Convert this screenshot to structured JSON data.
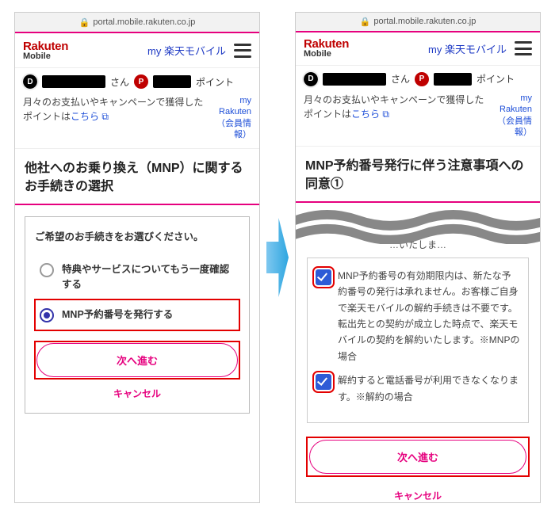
{
  "url": "portal.mobile.rakuten.co.jp",
  "brand": {
    "top": "Rakuten",
    "bottom": "Mobile"
  },
  "header": {
    "my_title": "my 楽天モバイル"
  },
  "userbar": {
    "san": "さん",
    "points_suffix": "ポイント"
  },
  "infoline": {
    "text_pre": "月々のお支払いやキャンペーンで獲得したポイントは",
    "link": "こちら",
    "myrakuten": "my Rakuten（会員情報）"
  },
  "left": {
    "title": "他社へのお乗り換え（MNP）に関するお手続きの選択",
    "card_lead": "ご希望のお手続きをお選びください。",
    "option1": "特典やサービスについてもう一度確認する",
    "option2": "MNP予約番号を発行する",
    "next": "次へ進む",
    "cancel": "キャンセル"
  },
  "right": {
    "title": "MNP予約番号発行に伴う注意事項への同意①",
    "fragment": "…いたしま…",
    "agree1": "MNP予約番号の有効期限内は、新たな予約番号の発行は承れません。お客様ご自身で楽天モバイルの解約手続きは不要です。転出先との契約が成立した時点で、楽天モバイルの契約を解約いたします。※MNPの場合",
    "agree2": "解約すると電話番号が利用できなくなります。※解約の場合",
    "next": "次へ進む",
    "cancel": "キャンセル"
  }
}
